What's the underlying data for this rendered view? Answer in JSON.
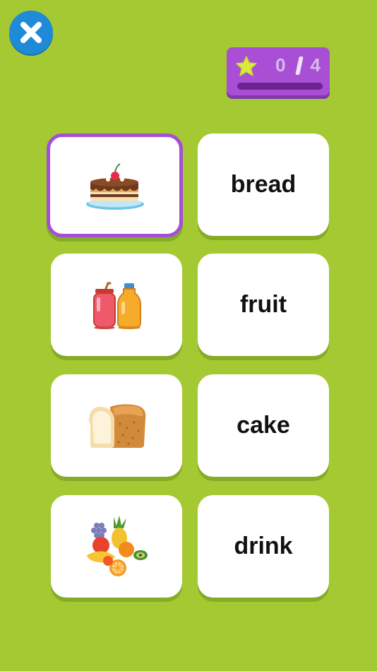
{
  "score": {
    "current": "0",
    "total": "4",
    "progress": 0,
    "icon": "star-icon"
  },
  "close_button": {
    "icon": "close-icon",
    "color": "#1f8ad8"
  },
  "colors": {
    "background": "#a5c932",
    "accent": "#a84fd6",
    "selected_border": "#a44fd8"
  },
  "picture_cards": [
    {
      "icon": "cake-icon",
      "selected": true
    },
    {
      "icon": "drinks-icon",
      "selected": false
    },
    {
      "icon": "bread-icon",
      "selected": false
    },
    {
      "icon": "fruit-icon",
      "selected": false
    }
  ],
  "word_cards": [
    {
      "word": "bread"
    },
    {
      "word": "fruit"
    },
    {
      "word": "cake"
    },
    {
      "word": "drink"
    }
  ]
}
